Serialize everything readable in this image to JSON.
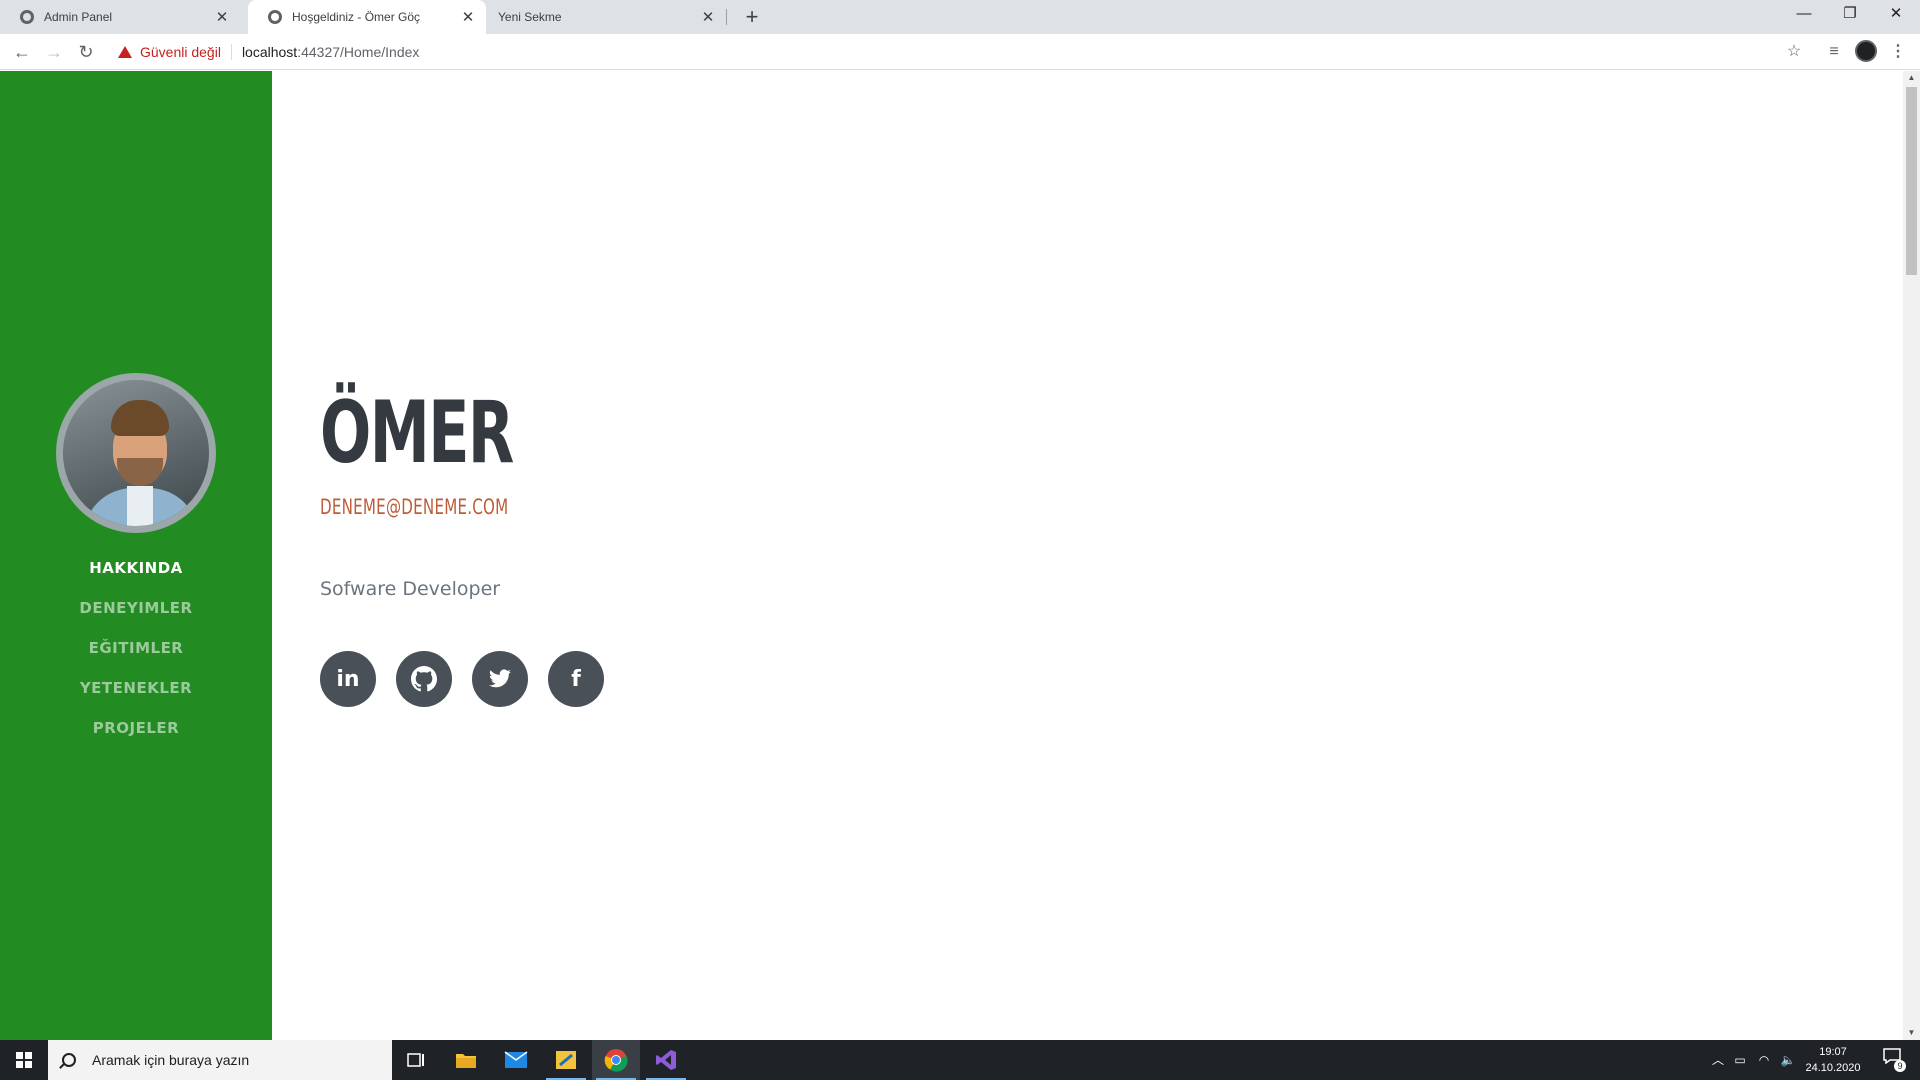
{
  "browser": {
    "tabs": [
      {
        "title": "Admin Panel",
        "active": false
      },
      {
        "title": "Hoşgeldiniz - Ömer Göç",
        "active": true
      },
      {
        "title": "Yeni Sekme",
        "active": false
      }
    ],
    "security_label": "Güvenli değil",
    "url_host": "localhost",
    "url_rest": ":44327/Home/Index"
  },
  "sidebar": {
    "background": "#228b22",
    "nav": [
      {
        "label": "HAKKINDA",
        "active": true
      },
      {
        "label": "DENEYIMLER",
        "active": false
      },
      {
        "label": "EĞITIMLER",
        "active": false
      },
      {
        "label": "YETENEKLER",
        "active": false
      },
      {
        "label": "PROJELER",
        "active": false
      }
    ]
  },
  "profile": {
    "name": "ÖMER",
    "email": "DENEME@DENEME.COM",
    "role": "Sofware Developer"
  },
  "socials": [
    {
      "icon": "linkedin-icon",
      "glyph": "in"
    },
    {
      "icon": "github-icon",
      "glyph": "◉"
    },
    {
      "icon": "twitter-icon",
      "glyph": "🐦"
    },
    {
      "icon": "facebook-icon",
      "glyph": "f"
    }
  ],
  "taskbar": {
    "search_placeholder": "Aramak için buraya yazın",
    "time": "19:07",
    "date": "24.10.2020",
    "notification_count": "9"
  }
}
